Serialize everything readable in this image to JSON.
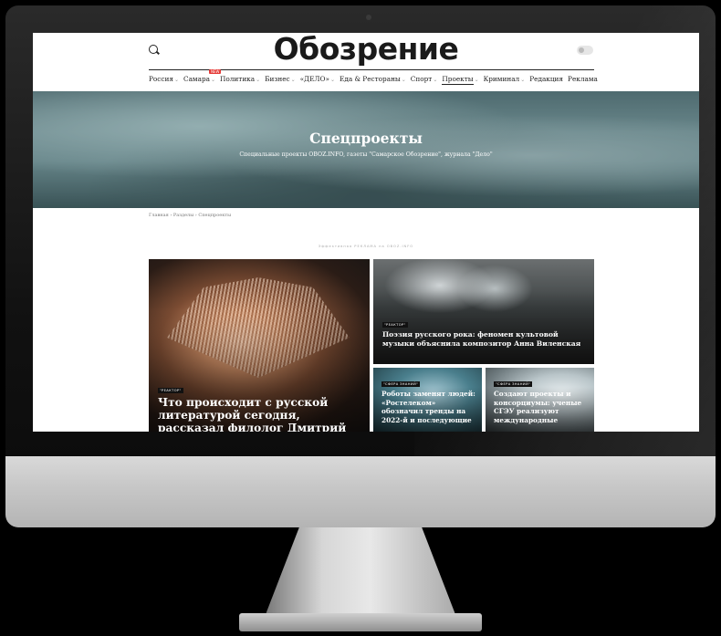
{
  "site": {
    "logo": "Обозрение"
  },
  "nav": {
    "items": [
      {
        "label": "Россия",
        "chevron": "⌄"
      },
      {
        "label": "Самара",
        "chevron": "⌄",
        "badge": "NEW"
      },
      {
        "label": "Политика",
        "chevron": "⌄"
      },
      {
        "label": "Бизнес",
        "chevron": "⌄"
      },
      {
        "label": "«ДЕЛО»",
        "chevron": "⌄"
      },
      {
        "label": "Еда & Рестораны",
        "chevron": "⌄"
      },
      {
        "label": "Спорт",
        "chevron": "⌄"
      },
      {
        "label": "Проекты",
        "chevron": "⌄"
      },
      {
        "label": "Криминал",
        "chevron": "⌄"
      },
      {
        "label": "Редакция",
        "chevron": ""
      },
      {
        "label": "Реклама",
        "chevron": ""
      }
    ]
  },
  "hero": {
    "title": "Спецпроекты",
    "subtitle": "Специальные проекты OBOZ.INFO, газеты \"Самарское Обозрение\", журнала \"Дело\""
  },
  "breadcrumb": {
    "text": "Главная › Разделы › Спецпроекты"
  },
  "ad_label": "Эффективная РЕКЛАМА на OBOZ.INFO",
  "cards": {
    "big": {
      "tag": "\"РЕАКТОР\"",
      "title": "Что происходит с русской литературой сегодня, рассказал филолог Дмитрий Крайт"
    },
    "top": {
      "tag": "\"РЕАКТОР\"",
      "title": "Поэзия русского рока: феномен культовой музыки объяснила композитор Анна Виленская"
    },
    "small1": {
      "tag": "\"СФЕРА ЗНАНИЙ\"",
      "title": "Роботы заменят людей: «Ростелеком» обозначил тренды на 2022-й и последующие"
    },
    "small2": {
      "tag": "\"СФЕРА ЗНАНИЙ\"",
      "title": "Создают проекты и консорциумы: ученые СГЭУ реализуют международные"
    }
  },
  "colors": {
    "badge": "#e53935",
    "text": "#222222"
  }
}
